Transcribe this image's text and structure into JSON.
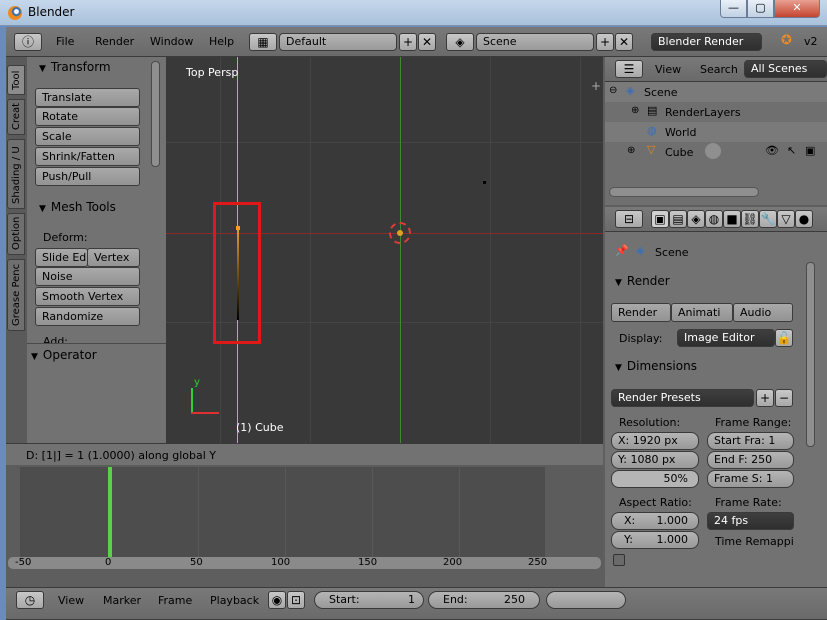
{
  "window": {
    "title": "Blender",
    "buttons": {
      "minimize": "—",
      "maximize": "▢",
      "close": "✕"
    }
  },
  "info_header": {
    "menus": [
      "File",
      "Render",
      "Window",
      "Help"
    ],
    "screen_layout": "Default",
    "scene": "Scene",
    "engine": "Blender Render",
    "version": "v2"
  },
  "tool_tabs": [
    "Tool",
    "Creat",
    "Shading / U",
    "Option",
    "Grease Penc"
  ],
  "toolshelf": {
    "transform_title": "Transform",
    "transform_buttons": [
      "Translate",
      "Rotate",
      "Scale",
      "Shrink/Fatten",
      "Push/Pull"
    ],
    "mesh_tools_title": "Mesh Tools",
    "deform_label": "Deform:",
    "slide_edge": "Slide Ed",
    "vertex": "Vertex",
    "mesh_buttons": [
      "Noise",
      "Smooth Vertex",
      "Randomize"
    ],
    "add_label": "Add:",
    "operator_title": "Operator"
  },
  "viewport": {
    "view_label": "Top Persp",
    "object_label": "(1) Cube",
    "axis_y": "y",
    "highlight_color": "#e01818"
  },
  "status": {
    "text": "D: [1|] = 1 (1.0000) along global Y"
  },
  "timeline": {
    "ticks": [
      "-50",
      "0",
      "50",
      "100",
      "150",
      "200",
      "250"
    ],
    "current_frame_color": "#5bd04a",
    "menus": [
      "View",
      "Marker",
      "Frame",
      "Playback"
    ],
    "start_label": "Start:",
    "start_value": "1",
    "end_label": "End:",
    "end_value": "250"
  },
  "outliner": {
    "menus": [
      "View",
      "Search"
    ],
    "filter": "All Scenes",
    "items": [
      {
        "label": "Scene",
        "icon": "scene-icon"
      },
      {
        "label": "RenderLayers",
        "icon": "renderlayers-icon"
      },
      {
        "label": "World",
        "icon": "world-icon"
      },
      {
        "label": "Cube",
        "icon": "mesh-icon"
      }
    ]
  },
  "properties": {
    "context": "Scene",
    "render_title": "Render",
    "render_buttons": [
      "Render",
      "Animati",
      "Audio"
    ],
    "display_label": "Display:",
    "display_value": "Image Editor",
    "dimensions_title": "Dimensions",
    "render_presets": "Render Presets",
    "resolution_label": "Resolution:",
    "res_x": "X: 1920 px",
    "res_y": "Y: 1080 px",
    "res_pct": "50%",
    "frame_range_label": "Frame Range:",
    "start_frame": "Start Fra: 1",
    "end_frame": "End F: 250",
    "frame_step": "Frame S: 1",
    "aspect_label": "Aspect Ratio:",
    "aspect_x_label": "X:",
    "aspect_x": "1.000",
    "aspect_y_label": "Y:",
    "aspect_y": "1.000",
    "frame_rate_label": "Frame Rate:",
    "frame_rate": "24 fps",
    "time_remap": "Time Remappi"
  }
}
